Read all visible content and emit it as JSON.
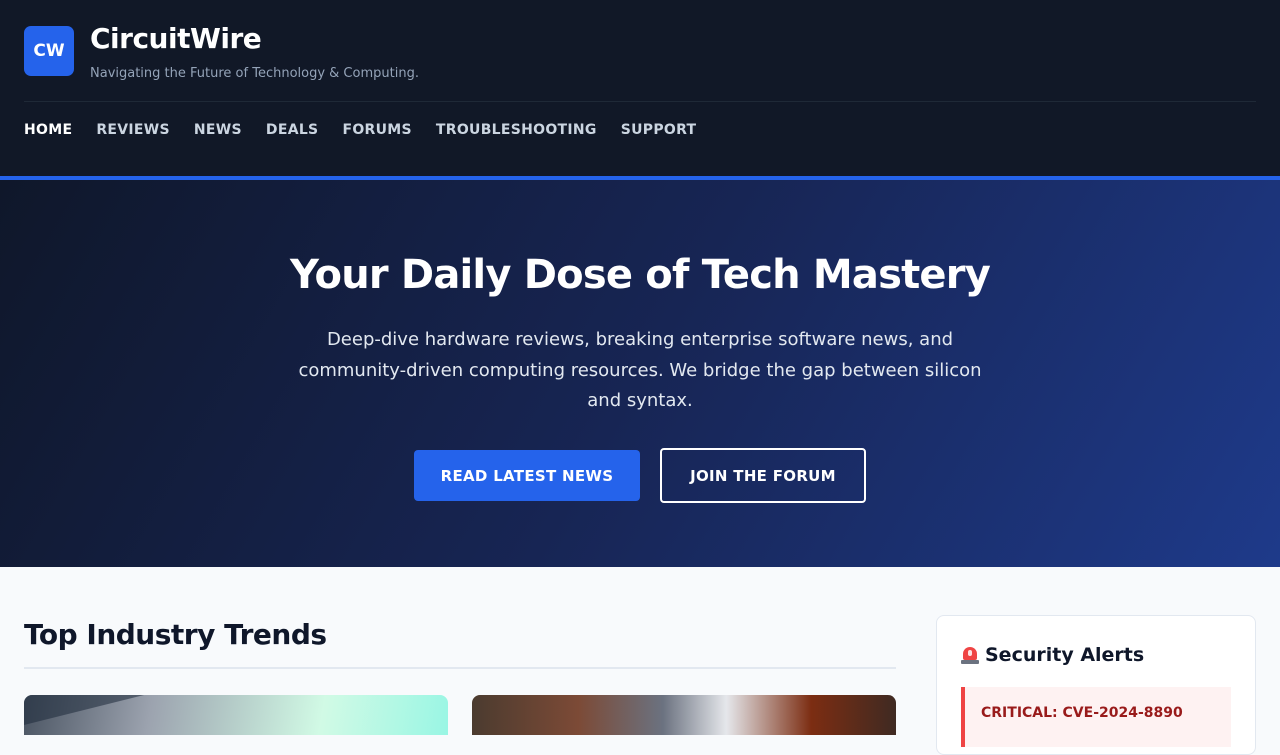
{
  "brand": {
    "logo_text": "CW",
    "title": "CircuitWire",
    "tagline": "Navigating the Future of Technology & Computing."
  },
  "nav": {
    "items": [
      {
        "label": "HOME",
        "active": true
      },
      {
        "label": "REVIEWS",
        "active": false
      },
      {
        "label": "NEWS",
        "active": false
      },
      {
        "label": "DEALS",
        "active": false
      },
      {
        "label": "FORUMS",
        "active": false
      },
      {
        "label": "TROUBLESHOOTING",
        "active": false
      },
      {
        "label": "SUPPORT",
        "active": false
      }
    ]
  },
  "hero": {
    "title": "Your Daily Dose of Tech Mastery",
    "subtitle": "Deep-dive hardware reviews, breaking enterprise software news, and community-driven computing resources. We bridge the gap between silicon and syntax.",
    "primary_button": "READ LATEST NEWS",
    "secondary_button": "JOIN THE FORUM"
  },
  "trends": {
    "title": "Top Industry Trends"
  },
  "security_alerts": {
    "icon": "siren-icon",
    "title": "Security Alerts",
    "items": [
      {
        "label": "CRITICAL: CVE-2024-8890"
      }
    ]
  },
  "colors": {
    "header_bg": "#111827",
    "accent": "#2563eb",
    "alert": "#ef4444"
  }
}
